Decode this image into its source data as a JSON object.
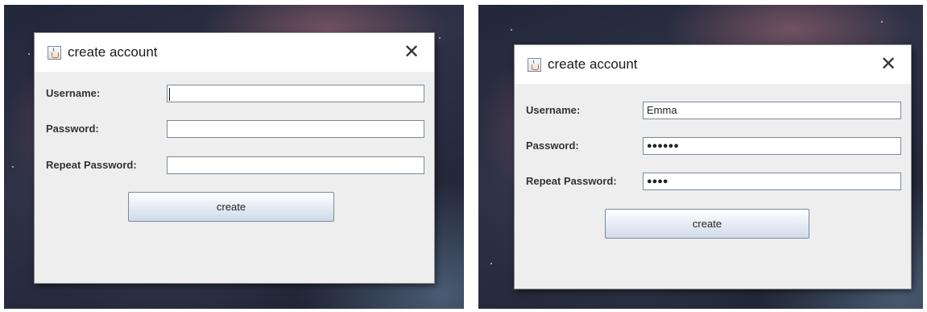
{
  "screens": [
    {
      "window": {
        "title": "create account",
        "close_glyph": "✕"
      },
      "fields": [
        {
          "label": "Username:",
          "value": "",
          "masked_length": 0
        },
        {
          "label": "Password:",
          "value": "",
          "masked_length": 0
        },
        {
          "label": "Repeat Password:",
          "value": "",
          "masked_length": 0
        }
      ],
      "create_label": "create"
    },
    {
      "window": {
        "title": "create account",
        "close_glyph": "✕"
      },
      "fields": [
        {
          "label": "Username:",
          "value": "Emma",
          "masked_length": 0
        },
        {
          "label": "Password:",
          "value": "●●●●●●",
          "masked_length": 6
        },
        {
          "label": "Repeat Password:",
          "value": "●●●●",
          "masked_length": 4
        }
      ],
      "create_label": "create"
    }
  ],
  "icons": {
    "app": "java-icon",
    "close": "close-icon"
  }
}
